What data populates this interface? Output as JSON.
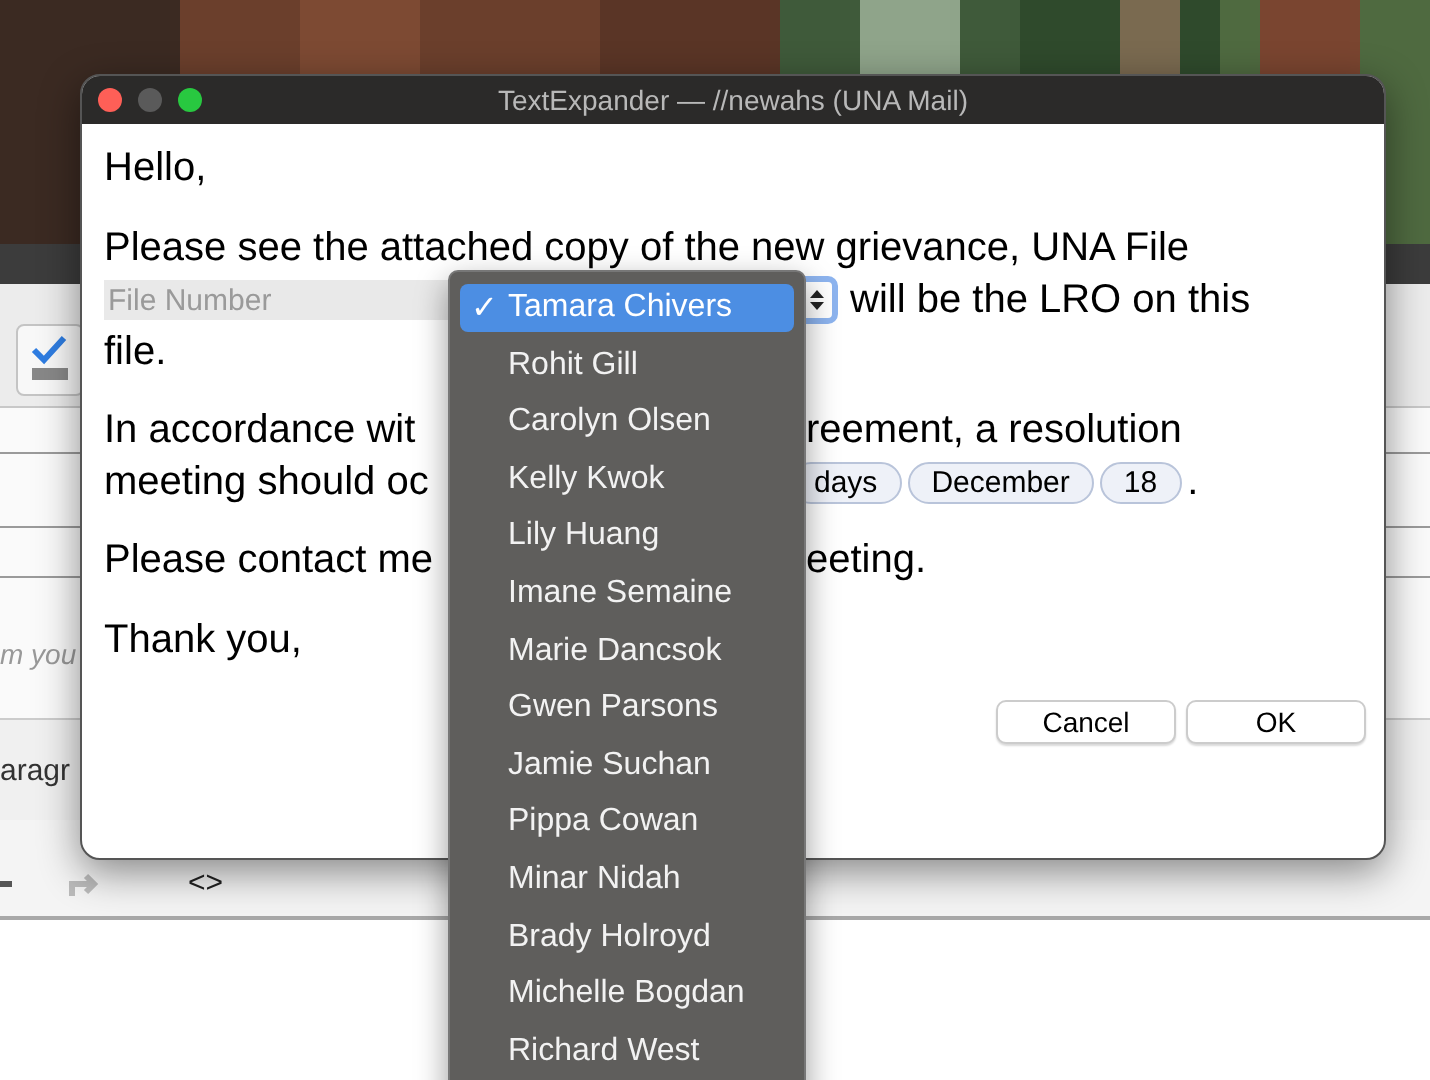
{
  "background_app": {
    "compose_hint": "m you",
    "format_label": "aragr",
    "code_button": "<>"
  },
  "window": {
    "title": "TextExpander — //newahs (UNA Mail)"
  },
  "snippet": {
    "greeting": "Hello,",
    "line_1": "Please see the attached copy of the new grievance, UNA File",
    "file_number": {
      "placeholder": "File Number"
    },
    "line_2_after": "will be the LRO on this",
    "line_3": "file.",
    "line_4_left": "In accordance wit",
    "line_4_right": "reement, a resolution",
    "line_5_left": "meeting should oc",
    "tokens": [
      "days",
      "December",
      "18"
    ],
    "line_5_end": ".",
    "line_6_left": "Please contact me",
    "line_6_right": "eeting.",
    "closing": "Thank you,"
  },
  "buttons": [
    {
      "label": "Cancel"
    },
    {
      "label": "OK"
    }
  ],
  "menu": {
    "items": [
      {
        "label": "Tamara Chivers",
        "selected": true
      },
      {
        "label": "Rohit Gill",
        "selected": false
      },
      {
        "label": "Carolyn Olsen",
        "selected": false
      },
      {
        "label": "Kelly Kwok",
        "selected": false
      },
      {
        "label": "Lily Huang",
        "selected": false
      },
      {
        "label": "Imane Semaine",
        "selected": false
      },
      {
        "label": "Marie Dancsok",
        "selected": false
      },
      {
        "label": "Gwen Parsons",
        "selected": false
      },
      {
        "label": "Jamie Suchan",
        "selected": false
      },
      {
        "label": "Pippa Cowan",
        "selected": false
      },
      {
        "label": "Minar Nidah",
        "selected": false
      },
      {
        "label": "Brady Holroyd",
        "selected": false
      },
      {
        "label": "Michelle Bogdan",
        "selected": false
      },
      {
        "label": "Richard West",
        "selected": false
      }
    ],
    "check_mark": "✓"
  }
}
